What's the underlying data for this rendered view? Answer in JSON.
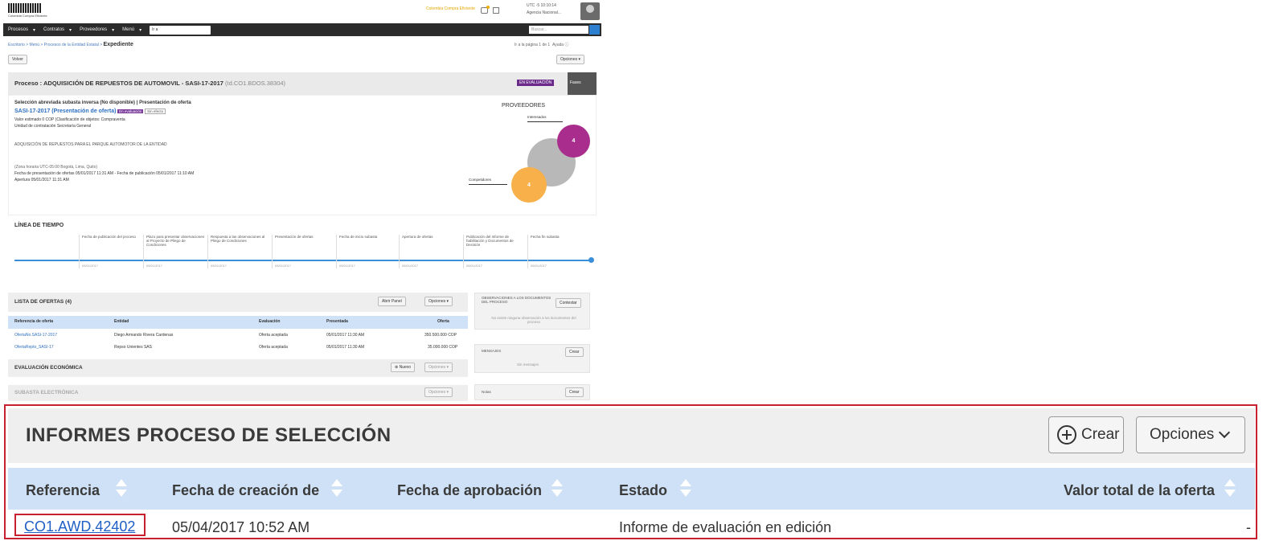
{
  "header": {
    "logo_text": "Colombia Compra Eficiente",
    "top_link": "Colombia Compra Eficiente",
    "user_line1": "UTC -5 10:10:14",
    "user_line2": "Agencia Nacional..."
  },
  "nav": {
    "items": [
      "Procesos",
      "Contratos",
      "Proveedores",
      "Menú"
    ],
    "select_value": "Ir a",
    "search_placeholder": "Buscar..."
  },
  "breadcrumb": {
    "trail": "Escritorio > Menú > Procesos de la Entidad Estatal > ",
    "current": "Expediente",
    "right_text": "Ir a la página 1 de 1",
    "ayuda": "Ayuda"
  },
  "buttons": {
    "volver": "Volver",
    "opciones_top": "Opciones"
  },
  "process": {
    "title": "Proceso : ADQUISICIÓN DE REPUESTOS DE AUTOMOVIL - SASI-17-2017",
    "id": "(Id.CO1.BDOS.38304)",
    "status_badge": "EN EVALUACIÓN",
    "fases": "Fases",
    "line1": "Selección abreviada subasta inversa (No disponible) | Presentación de oferta",
    "link": "SASI-17-2017 (Presentación de oferta)",
    "badge_eval": "En evaluación",
    "badge_draft": "Sin efecto",
    "line3": "Valor estimado 0 COP (Clasificación de objetos: Compraventa",
    "line4": "Unidad de contratación Secretaría General",
    "description": "ADQUISICIÓN DE REPUESTOS PARA EL PARQUE AUTOMOTOR DE LA ENTIDAD",
    "dates1": "(Zona horaria UTC-05:00 Bogotá, Lima, Quito)",
    "dates2": "Fecha de presentación de ofertas 05/01/2017 11:31 AM - Fecha de publicación 05/01/2017 11:10 AM",
    "dates3": "Apertura 05/01/2017 11:31 AM"
  },
  "providers": {
    "title": "PROVEEDORES",
    "label_interesados": "Interesados",
    "label_competidores": "Competidores",
    "count_a": "4",
    "count_b": "4"
  },
  "timeline": {
    "title": "LÍNEA DE TIEMPO",
    "steps": [
      {
        "label": "Fecha de publicación del proceso",
        "date": "05/01/2017"
      },
      {
        "label": "Plazo para presentar observaciones al Proyecto de Pliego de Condiciones",
        "date": "05/01/2017"
      },
      {
        "label": "Respuesta a las observaciones al Pliego de Condiciones",
        "date": "05/01/2017"
      },
      {
        "label": "Presentación de ofertas",
        "date": "05/01/2017"
      },
      {
        "label": "Fecha de inicio subasta",
        "date": "05/01/2017"
      },
      {
        "label": "Apertura de ofertas",
        "date": "05/01/2017"
      },
      {
        "label": "Publicación del Informe de habilitación y Documentos de Decisión",
        "date": "05/01/2017"
      },
      {
        "label": "Fecha fin subasta",
        "date": "05/01/2017"
      }
    ]
  },
  "offers": {
    "title": "LISTA DE OFERTAS (4)",
    "btn_abrir": "Abrir Panel",
    "btn_opciones": "Opciones",
    "headers": [
      "Referencia de oferta",
      "Entidad",
      "Evaluación",
      "Presentada",
      "Oferta"
    ],
    "rows": [
      [
        "OfertaNo.SASI-17-2017",
        "Diego Armando Rivera Cardenas",
        "Oferta aceptada",
        "05/01/2017 11:30 AM",
        "350.500.000 COP"
      ],
      [
        "OfertaRepto_SASI-17",
        "Repso Unientes SAS",
        "Oferta aceptada",
        "05/01/2017 11:30 AM",
        "35.000.000 COP"
      ]
    ]
  },
  "eval_econ": {
    "title": "EVALUACIÓN ECONÓMICA",
    "btn_nuevo": "Nuevo",
    "btn_opciones": "Opciones"
  },
  "subasta": {
    "title": "SUBASTA ELECTRÓNICA",
    "btn_opciones": "Opciones"
  },
  "side": {
    "obs_title": "OBSERVACIONES A LOS DOCUMENTOS DEL PROCESO",
    "obs_btn": "Contestar",
    "obs_text": "No existe ninguna observación a los documentos del proceso",
    "msg_title": "MENSAJES",
    "msg_btn": "Crear",
    "msg_text": "Sin mensajes",
    "notes_title": "Notas",
    "notes_btn": "Crear"
  },
  "report": {
    "title": "INFORMES PROCESO DE SELECCIÓN",
    "btn_crear": "Crear",
    "btn_opciones": "Opciones",
    "headers": {
      "referencia": "Referencia",
      "fecha_creacion": "Fecha de creación de",
      "fecha_aprobacion": "Fecha de aprobación",
      "estado": "Estado",
      "valor": "Valor total de la oferta"
    },
    "row": {
      "referencia": "CO1.AWD.42402",
      "fecha_creacion": "05/04/2017 10:52 AM",
      "fecha_aprobacion": "",
      "estado": "Informe de evaluación en edición",
      "valor": "-"
    }
  },
  "colors": {
    "highlight_border": "#c8202f",
    "table_header": "#cfe1f6",
    "link": "#1f5fc6",
    "bubble_purple": "#a82d8c",
    "bubble_orange": "#f7b04a",
    "bubble_grey": "#b8b8b8"
  }
}
